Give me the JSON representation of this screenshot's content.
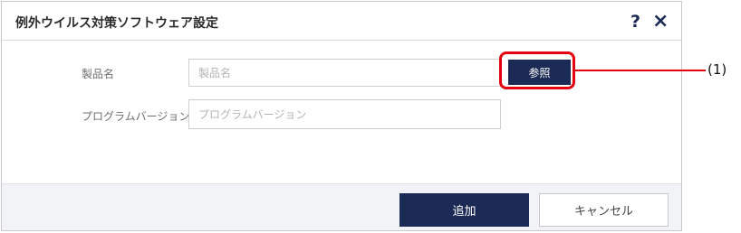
{
  "dialog": {
    "title": "例外ウイルス対策ソフトウェア設定",
    "help_icon": "?",
    "close_icon": "×"
  },
  "form": {
    "product_name": {
      "label": "製品名",
      "value": "",
      "placeholder": "製品名"
    },
    "program_version": {
      "label": "プログラムバージョン",
      "value": "",
      "placeholder": "プログラムバージョン"
    },
    "browse_label": "参照"
  },
  "annotation": {
    "label": "(1)",
    "color": "#e3000f"
  },
  "footer": {
    "add_label": "追加",
    "cancel_label": "キャンセル"
  },
  "colors": {
    "primary": "#1c2b55",
    "footer_bg": "#f1f3f6"
  }
}
